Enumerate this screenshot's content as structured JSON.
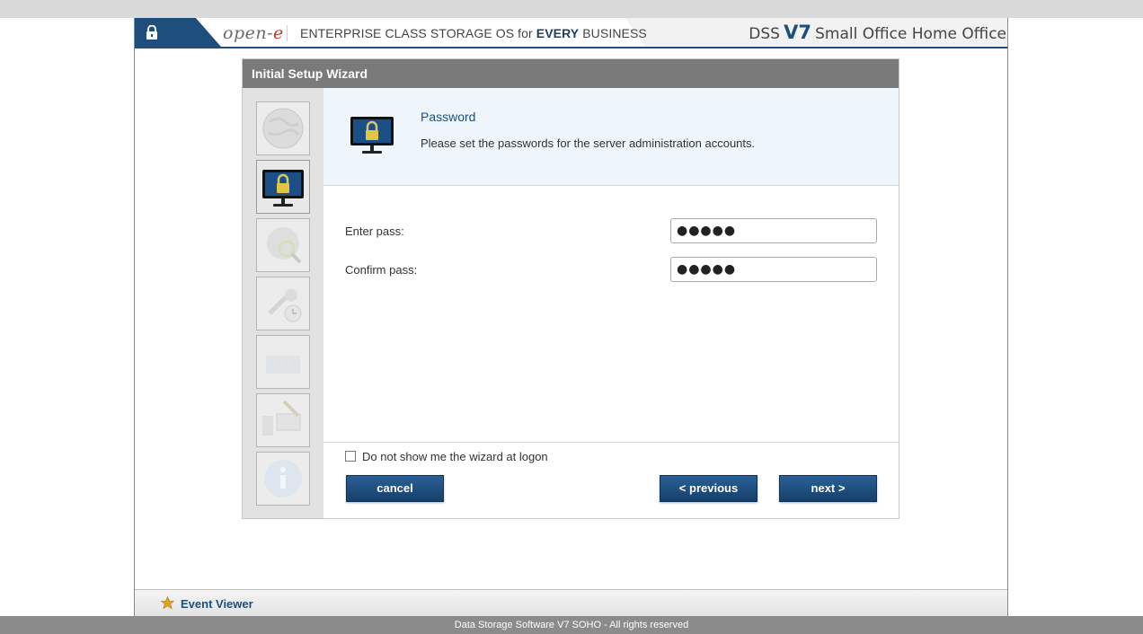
{
  "header": {
    "logo_main": "open-",
    "logo_e": "e",
    "tagline_pre": "ENTERPRISE CLASS STORAGE OS for ",
    "tagline_bold": "EVERY",
    "tagline_post": " BUSINESS",
    "brand_dss": "DSS",
    "brand_v7": "V7",
    "brand_edition": "Small Office Home Office"
  },
  "wizard": {
    "title": "Initial Setup Wizard",
    "step_title": "Password",
    "step_description": "Please set the passwords for the server administration accounts.",
    "steps": [
      {
        "icon": "globe-icon",
        "active": false
      },
      {
        "icon": "monitor-lock-icon",
        "active": true
      },
      {
        "icon": "network-search-icon",
        "active": false
      },
      {
        "icon": "tools-clock-icon",
        "active": false
      },
      {
        "icon": "calendar-grid-icon",
        "active": false
      },
      {
        "icon": "pc-brush-icon",
        "active": false
      },
      {
        "icon": "info-icon",
        "active": false
      }
    ],
    "fields": {
      "enter_pass_label": "Enter pass:",
      "enter_pass_value": "●●●●●",
      "confirm_pass_label": "Confirm pass:",
      "confirm_pass_value": "●●●●●"
    },
    "checkbox_label": "Do not show me the wizard at logon",
    "buttons": {
      "cancel": "cancel",
      "previous": "< previous",
      "next": "next >"
    }
  },
  "bottom": {
    "event_viewer": "Event Viewer",
    "copyright": "Data Storage Software V7 SOHO - All rights reserved"
  },
  "colors": {
    "accent": "#1d4e7c",
    "wizard_title_bg": "#7a7a7a",
    "info_bg": "#eef6fc",
    "footer_bg": "#8b8b8b"
  }
}
